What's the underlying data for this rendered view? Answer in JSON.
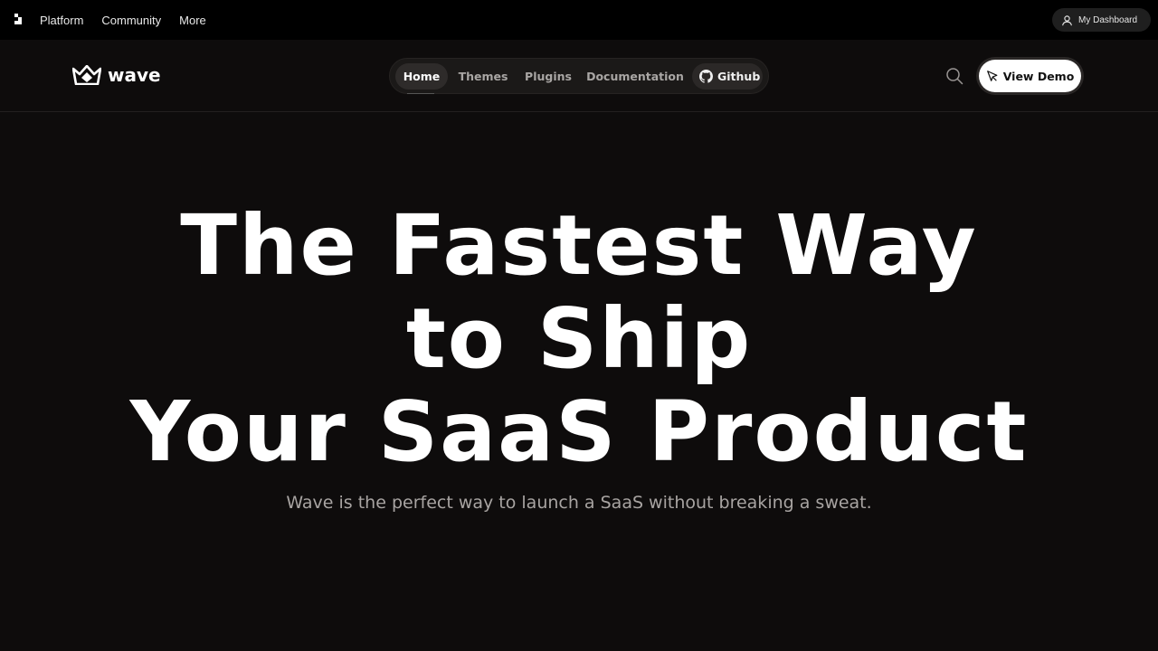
{
  "topbar": {
    "nav": [
      "Platform",
      "Community",
      "More"
    ],
    "dashboard_label": "My Dashboard"
  },
  "header": {
    "brand": "wave",
    "nav": [
      {
        "label": "Home",
        "active": true
      },
      {
        "label": "Themes",
        "active": false
      },
      {
        "label": "Plugins",
        "active": false
      },
      {
        "label": "Documentation",
        "active": false
      },
      {
        "label": "Github",
        "active": false
      }
    ],
    "demo_label": "View Demo"
  },
  "hero": {
    "title_lines": [
      "The Fastest Way",
      "to Ship",
      "Your SaaS Product"
    ],
    "subtitle": "Wave is the perfect way to launch a SaaS without breaking a sweat."
  },
  "icons": {
    "dev_logo": "devdojo-logo-icon",
    "user": "user-icon",
    "crown": "crown-icon",
    "github": "github-icon",
    "search": "search-icon",
    "cursor": "cursor-icon"
  },
  "colors": {
    "background": "#0e0c0c",
    "topbar": "#000000",
    "nav_pill": "#1b1918",
    "subtitle": "#a8a4a2",
    "demo_button": "#ffffff"
  }
}
